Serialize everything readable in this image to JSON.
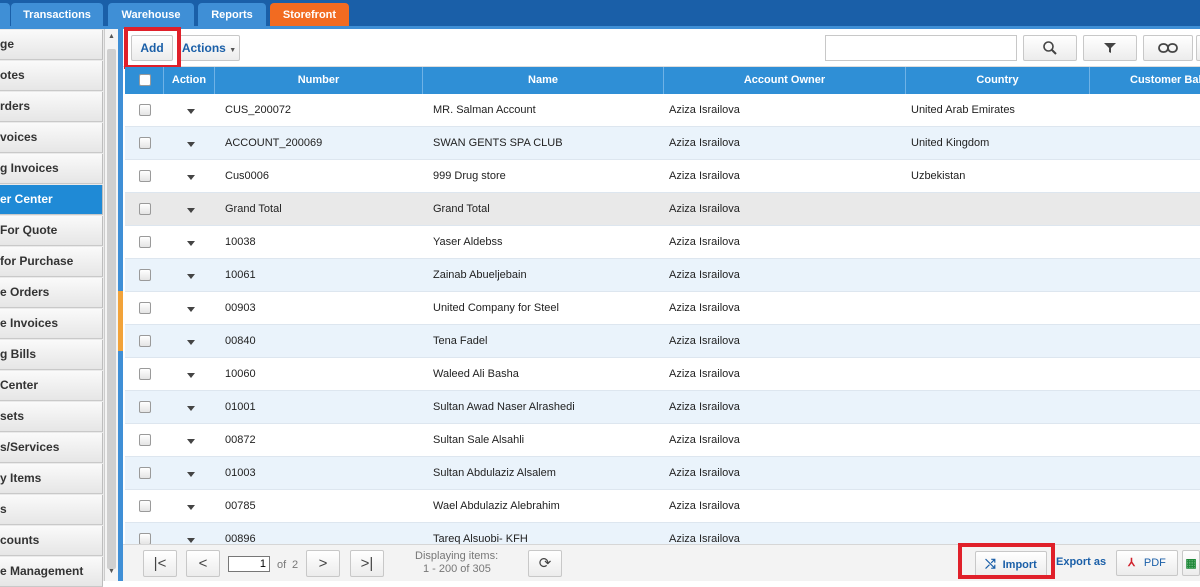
{
  "nav": {
    "tabs": [
      {
        "label": "Transactions"
      },
      {
        "label": "Warehouse"
      },
      {
        "label": "Reports"
      },
      {
        "label": "Storefront"
      }
    ]
  },
  "sidebar": {
    "items": [
      {
        "label": "ge"
      },
      {
        "label": "otes"
      },
      {
        "label": "rders"
      },
      {
        "label": "voices"
      },
      {
        "label": "g Invoices"
      },
      {
        "label": "er Center"
      },
      {
        "label": "For Quote"
      },
      {
        "label": "for Purchase"
      },
      {
        "label": "e Orders"
      },
      {
        "label": "e Invoices"
      },
      {
        "label": "g Bills"
      },
      {
        "label": "Center"
      },
      {
        "label": "sets"
      },
      {
        "label": "s/Services"
      },
      {
        "label": "y Items"
      },
      {
        "label": "s"
      },
      {
        "label": "counts"
      },
      {
        "label": "e Management"
      }
    ]
  },
  "toolbar": {
    "add_label": "Add",
    "actions_label": "Actions",
    "search_value": ""
  },
  "grid": {
    "columns": [
      "Action",
      "Number",
      "Name",
      "Account Owner",
      "Country",
      "Customer Balance"
    ],
    "rows": [
      {
        "number": "CUS_200072",
        "name": "MR. Salman Account",
        "owner": "Aziza Israilova",
        "country": "United Arab Emirates"
      },
      {
        "number": "ACCOUNT_200069",
        "name": "SWAN GENTS SPA CLUB",
        "owner": "Aziza Israilova",
        "country": "United Kingdom"
      },
      {
        "number": "Cus0006",
        "name": "999 Drug store",
        "owner": "Aziza Israilova",
        "country": "Uzbekistan"
      },
      {
        "number": "Grand Total",
        "name": "Grand Total",
        "owner": "Aziza Israilova",
        "country": ""
      },
      {
        "number": "10038",
        "name": "Yaser Aldebss",
        "owner": "Aziza Israilova",
        "country": ""
      },
      {
        "number": "10061",
        "name": "Zainab Abueljebain",
        "owner": "Aziza Israilova",
        "country": ""
      },
      {
        "number": "00903",
        "name": "United Company for Steel",
        "owner": "Aziza Israilova",
        "country": ""
      },
      {
        "number": "00840",
        "name": "Tena Fadel",
        "owner": "Aziza Israilova",
        "country": ""
      },
      {
        "number": "10060",
        "name": "Waleed Ali Basha",
        "owner": "Aziza Israilova",
        "country": ""
      },
      {
        "number": "01001",
        "name": "Sultan Awad Naser Alrashedi",
        "owner": "Aziza Israilova",
        "country": ""
      },
      {
        "number": "00872",
        "name": "Sultan Sale Alsahli",
        "owner": "Aziza Israilova",
        "country": ""
      },
      {
        "number": "01003",
        "name": "Sultan Abdulaziz Alsalem",
        "owner": "Aziza Israilova",
        "country": ""
      },
      {
        "number": "00785",
        "name": "Wael Abdulaziz Alebrahim",
        "owner": "Aziza Israilova",
        "country": ""
      },
      {
        "number": "00896",
        "name": "Tareq Alsuobi- KFH",
        "owner": "Aziza Israilova",
        "country": ""
      }
    ]
  },
  "footer": {
    "page_value": "1",
    "of_label": "of",
    "total_pages": "2",
    "displaying_label": "Displaying items:",
    "displaying_range": "1 - 200 of 305",
    "import_label": "Import",
    "export_label": "Export as",
    "pdf_label": "PDF"
  },
  "colors": {
    "nav_bg": "#1a5fa8",
    "tab_bg": "#3f8fd6",
    "active_tab": "#f26b21",
    "header_bg": "#2f8fd6",
    "highlight_box": "#e0202a"
  }
}
